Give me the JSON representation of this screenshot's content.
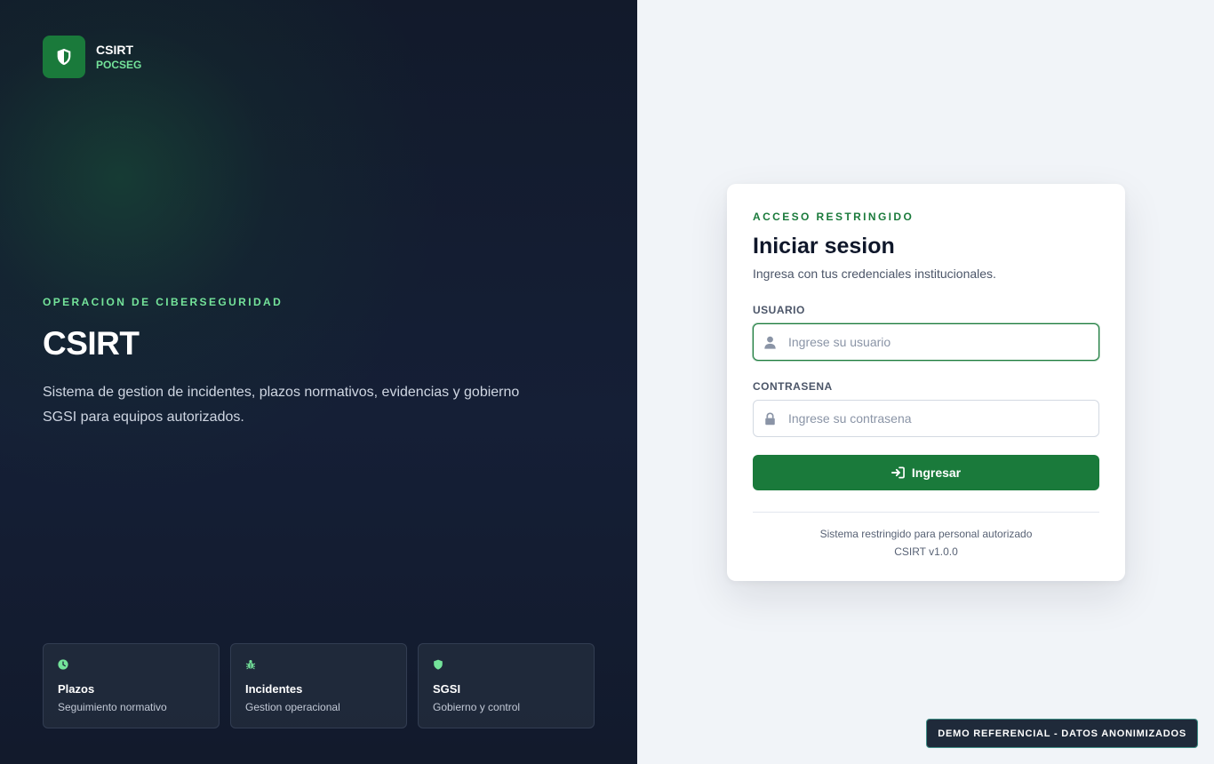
{
  "brand": {
    "name": "CSIRT",
    "sub": "POCSEG",
    "icon": "shield-icon"
  },
  "hero": {
    "eyebrow": "OPERACION DE CIBERSEGURIDAD",
    "title": "CSIRT",
    "description": "Sistema de gestion de incidentes, plazos normativos, evidencias y gobierno SGSI para equipos autorizados."
  },
  "features": [
    {
      "icon": "clock-icon",
      "title": "Plazos",
      "subtitle": "Seguimiento normativo"
    },
    {
      "icon": "bug-icon",
      "title": "Incidentes",
      "subtitle": "Gestion operacional"
    },
    {
      "icon": "shield-icon",
      "title": "SGSI",
      "subtitle": "Gobierno y control"
    }
  ],
  "login": {
    "eyebrow": "ACCESO RESTRINGIDO",
    "title": "Iniciar sesion",
    "subtitle": "Ingresa con tus credenciales institucionales.",
    "username": {
      "label": "USUARIO",
      "placeholder": "Ingrese su usuario",
      "value": "",
      "icon": "user-icon"
    },
    "password": {
      "label": "CONTRASENA",
      "placeholder": "Ingrese su contrasena",
      "value": "",
      "icon": "lock-icon"
    },
    "submit": {
      "label": "Ingresar",
      "icon": "sign-in-icon"
    },
    "footer": {
      "line1": "Sistema restringido para personal autorizado",
      "line2": "CSIRT v1.0.0"
    }
  },
  "demo_badge": "DEMO REFERENCIAL - DATOS ANONIMIZADOS",
  "colors": {
    "accent": "#1a7a3b",
    "accent_light": "#74e39a",
    "dark_bg": "#121a2b",
    "light_bg": "#f1f4f8"
  }
}
